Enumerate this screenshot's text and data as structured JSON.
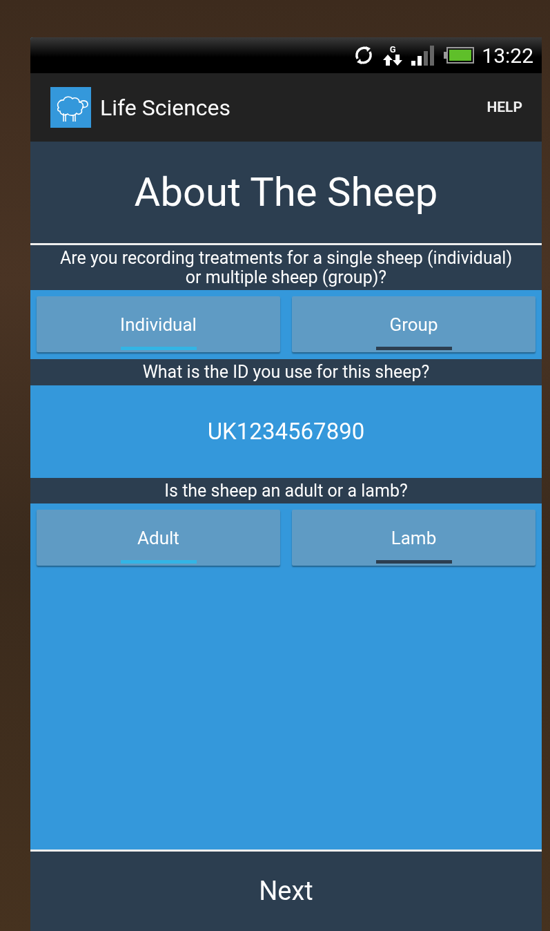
{
  "status_bar": {
    "network": "G",
    "time": "13:22"
  },
  "app_bar": {
    "title": "Life Sciences",
    "action": "HELP"
  },
  "page_title": "About The Sheep",
  "questions": [
    {
      "kind": "choice",
      "prompt": "Are you recording treatments for a single sheep (individual) or multiple sheep (group)?",
      "options": [
        {
          "label": "Individual",
          "selected": true
        },
        {
          "label": "Group",
          "selected": false
        }
      ]
    },
    {
      "kind": "text",
      "prompt": "What is the ID you use for this sheep?",
      "value": "UK1234567890"
    },
    {
      "kind": "choice",
      "prompt": "Is the sheep an adult or a lamb?",
      "options": [
        {
          "label": "Adult",
          "selected": true
        },
        {
          "label": "Lamb",
          "selected": false
        }
      ]
    }
  ],
  "next_button": "Next"
}
